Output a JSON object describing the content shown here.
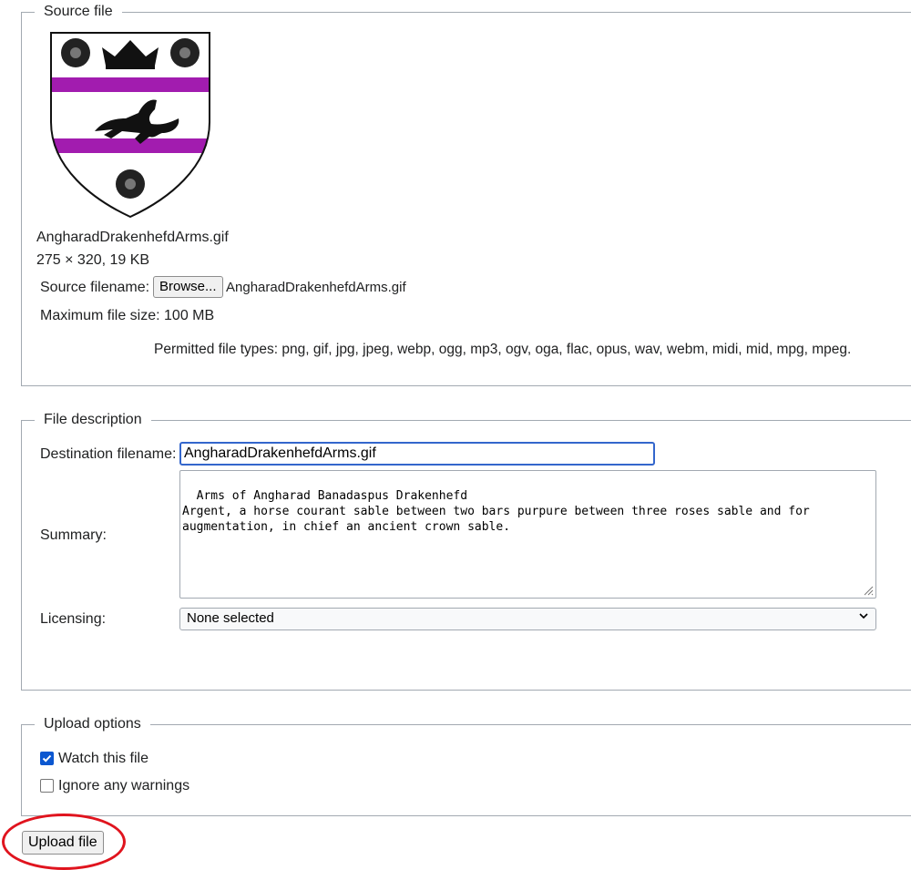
{
  "source_section": {
    "legend": "Source file",
    "file_name": "AngharadDrakenhefdArms.gif",
    "file_meta": "275 × 320, 19 KB",
    "source_filename_label": "Source filename:",
    "browse_label": "Browse...",
    "chosen_file": "AngharadDrakenhefdArms.gif",
    "max_size": "Maximum file size: 100 MB",
    "permitted_types": "Permitted file types: png, gif, jpg, jpeg, webp, ogg, mp3, ogv, oga, flac, opus, wav, webm, midi, mid, mpg, mpeg.",
    "preview_colors": {
      "field": "#ffffff",
      "bars": "#a21caf",
      "charges": "#111111"
    }
  },
  "description_section": {
    "legend": "File description",
    "destination_label": "Destination filename:",
    "destination_value": "AngharadDrakenhefdArms.gif",
    "summary_label": "Summary:",
    "summary_value": "Arms of Angharad Banadaspus Drakenhefd\nArgent, a horse courant sable between two bars purpure between three roses sable and for\naugmentation, in chief an ancient crown sable.",
    "licensing_label": "Licensing:",
    "licensing_value": "None selected"
  },
  "options_section": {
    "legend": "Upload options",
    "watch_label": "Watch this file",
    "watch_checked": true,
    "ignore_label": "Ignore any warnings",
    "ignore_checked": false
  },
  "upload_button_label": "Upload file",
  "colors": {
    "accent": "#3366cc",
    "checkbox": "#0b57d0",
    "highlight_ring": "#e0141e"
  }
}
